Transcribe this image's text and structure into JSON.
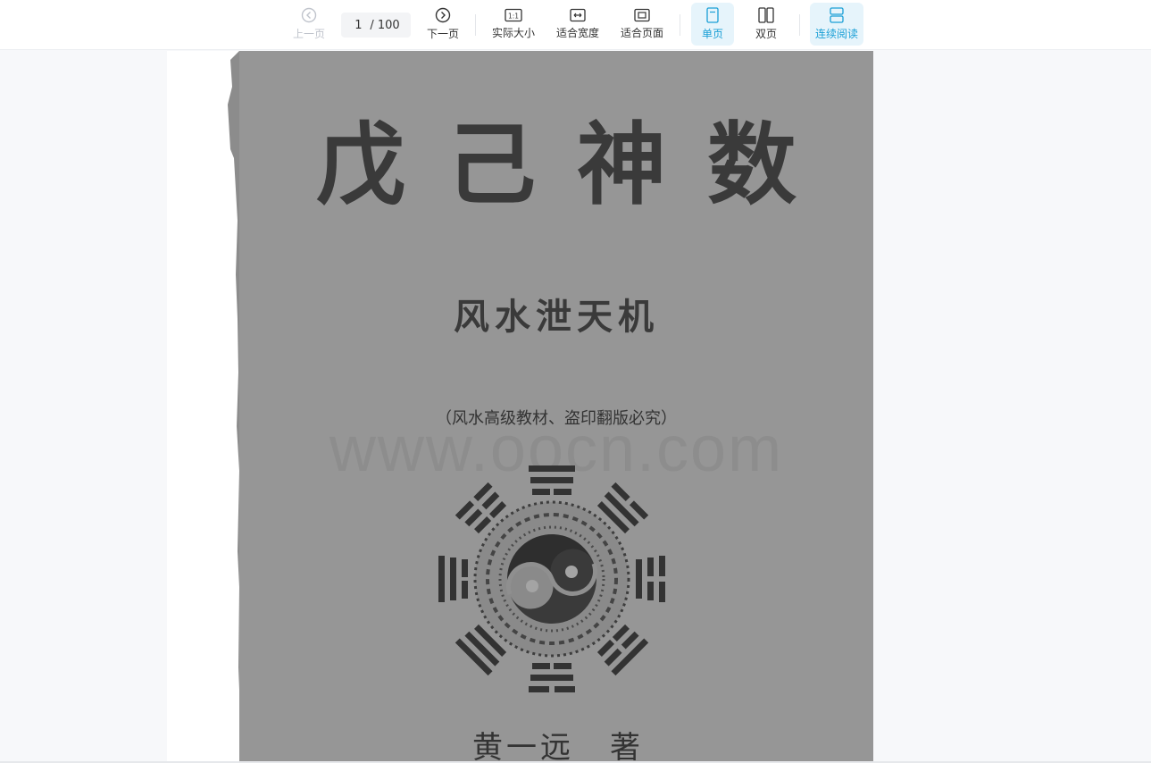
{
  "toolbar": {
    "prev_label": "上一页",
    "next_label": "下一页",
    "current_page": "1",
    "page_total": "/ 100",
    "actual_size_label": "实际大小",
    "fit_width_label": "适合宽度",
    "fit_page_label": "适合页面",
    "single_page_label": "单页",
    "double_page_label": "双页",
    "continuous_label": "连续阅读",
    "actual_size_glyph": "1:1",
    "active_color": "#1a9fd6",
    "active_bg": "#e6f4fb",
    "disabled_color": "#c0c4cc",
    "icons": {
      "prev": "chevron-left-circle-icon",
      "next": "chevron-right-circle-icon",
      "actual_size": "actual-size-icon",
      "fit_width": "fit-width-icon",
      "fit_page": "fit-page-icon",
      "single_page": "single-page-icon",
      "double_page": "double-page-icon",
      "continuous": "continuous-read-icon"
    }
  },
  "document": {
    "title": "戊己神数",
    "subtitle": "风水泄天机",
    "note": "（风水高级教材、盗印翻版必究）",
    "author_name": "黄一远",
    "author_role": "著",
    "watermark": "www.oocn.com",
    "cover_color": "#969696",
    "ink_color": "#3a3a3a"
  }
}
